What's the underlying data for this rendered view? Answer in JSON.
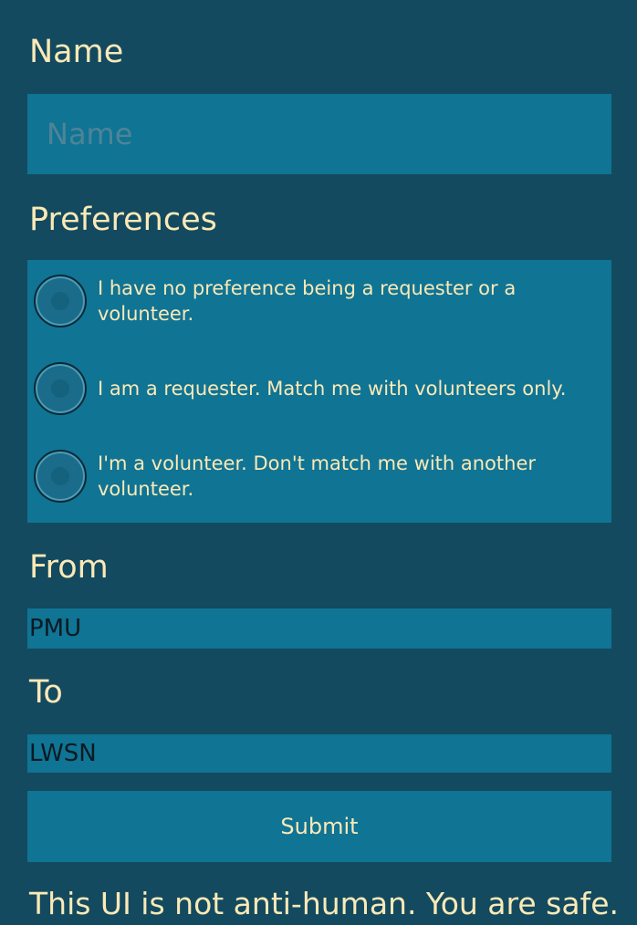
{
  "form": {
    "name_label": "Name",
    "name_placeholder": "Name",
    "preferences_label": "Preferences",
    "preferences": [
      {
        "label": "I have no preference being a requester or a volunteer.",
        "selected": false
      },
      {
        "label": "I am a requester. Match me with volunteers only.",
        "selected": false
      },
      {
        "label": "I'm a volunteer. Don't match me with another volunteer.",
        "selected": false
      }
    ],
    "from_label": "From",
    "from_value": "PMU",
    "to_label": "To",
    "to_value": "LWSN",
    "submit_label": "Submit"
  },
  "footer": {
    "message": "This UI is not anti-human. You are safe."
  },
  "colors": {
    "background": "#134a5f",
    "panel": "#107494",
    "label_text": "#fbe9b7",
    "field_text": "#0a1a22"
  }
}
